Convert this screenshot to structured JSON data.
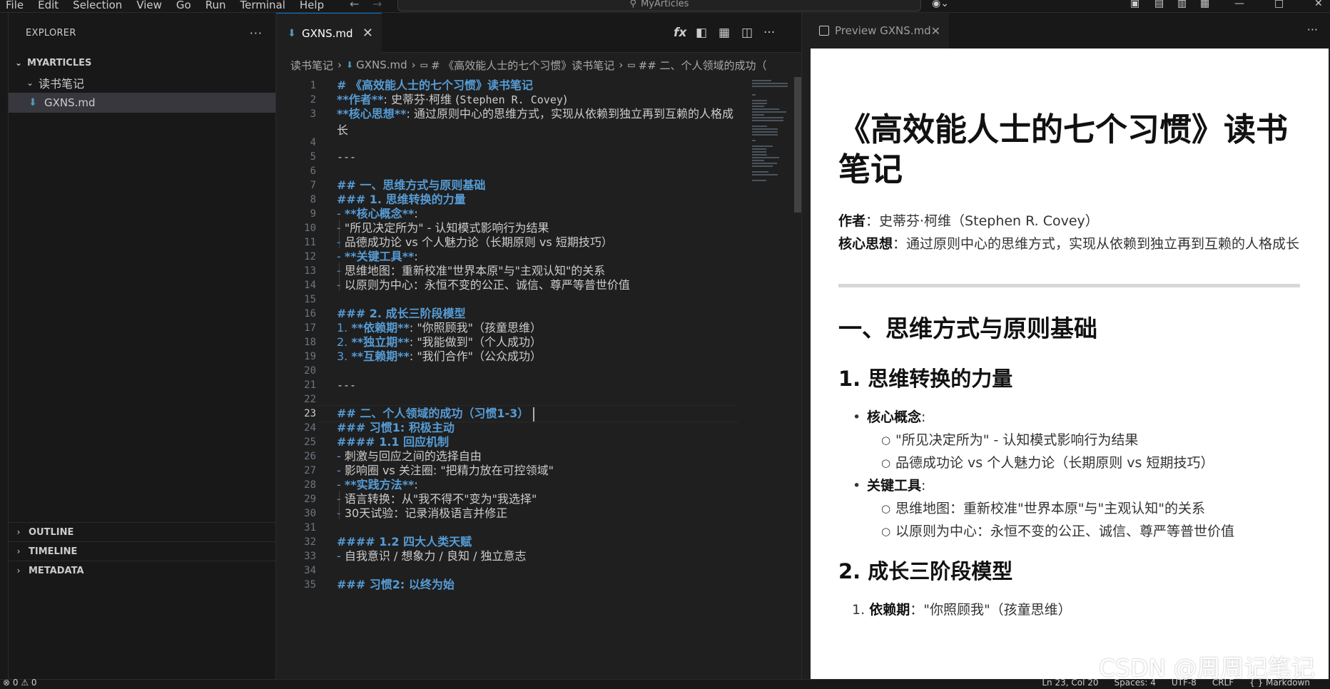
{
  "menu": [
    "File",
    "Edit",
    "Selection",
    "View",
    "Go",
    "Run",
    "Terminal",
    "Help"
  ],
  "command_center": {
    "label": "MyArticles",
    "icon": "search-icon"
  },
  "sidebar": {
    "title": "EXPLORER",
    "root": "MYARTICLES",
    "folder": "读书笔记",
    "file": "GXNS.md",
    "sections": [
      "OUTLINE",
      "TIMELINE",
      "METADATA"
    ]
  },
  "editor": {
    "tab_label": "GXNS.md",
    "breadcrumb": [
      "读书笔记",
      "GXNS.md",
      "# 《高效能人士的七个习惯》读书笔记",
      "## 二、个人领域的成功（"
    ],
    "cursor_line": 23,
    "lines": [
      {
        "n": "1",
        "parts": [
          {
            "t": "# 《高效能人士的七个习惯》读书笔记",
            "c": "hd"
          }
        ]
      },
      {
        "n": "2",
        "parts": [
          {
            "t": "**作者**",
            "c": "bd"
          },
          {
            "t": ": 史蒂芬·柯维 (",
            "c": "plain"
          },
          {
            "t": "Stephen R. Covey",
            "c": "plain mono"
          },
          {
            "t": ")",
            "c": "plain"
          }
        ]
      },
      {
        "n": "3",
        "wrap": true,
        "parts": [
          {
            "t": "**核心思想**",
            "c": "bd"
          },
          {
            "t": ": 通过原则中心的思维方式，实现从依赖到独立再到互赖的人格成长",
            "c": "plain"
          }
        ]
      },
      {
        "n": "4",
        "parts": []
      },
      {
        "n": "5",
        "parts": [
          {
            "t": "---",
            "c": "plain mono"
          }
        ]
      },
      {
        "n": "6",
        "parts": []
      },
      {
        "n": "7",
        "parts": [
          {
            "t": "## 一、思维方式与原则基础",
            "c": "hd"
          }
        ]
      },
      {
        "n": "8",
        "parts": [
          {
            "t": "### 1. 思维转换的力量",
            "c": "hd"
          }
        ]
      },
      {
        "n": "9",
        "parts": [
          {
            "t": "- ",
            "c": "bl"
          },
          {
            "t": "**核心概念**",
            "c": "bd"
          },
          {
            "t": ":",
            "c": "plain"
          }
        ]
      },
      {
        "n": "10",
        "parts": [
          {
            "t": "  - ",
            "c": "bl"
          },
          {
            "t": "\"所见决定所为\" - 认知模式影响行为结果",
            "c": "plain"
          }
        ]
      },
      {
        "n": "11",
        "parts": [
          {
            "t": "  - ",
            "c": "bl"
          },
          {
            "t": "品德成功论 vs 个人魅力论（长期原则 vs 短期技巧）",
            "c": "plain"
          }
        ]
      },
      {
        "n": "12",
        "parts": [
          {
            "t": "- ",
            "c": "bl"
          },
          {
            "t": "**关键工具**",
            "c": "bd"
          },
          {
            "t": ":",
            "c": "plain"
          }
        ]
      },
      {
        "n": "13",
        "parts": [
          {
            "t": "  - ",
            "c": "bl"
          },
          {
            "t": "思维地图：重新校准\"世界本原\"与\"主观认知\"的关系",
            "c": "plain"
          }
        ]
      },
      {
        "n": "14",
        "parts": [
          {
            "t": "  - ",
            "c": "bl"
          },
          {
            "t": "以原则为中心：永恒不变的公正、诚信、尊严等普世价值",
            "c": "plain"
          }
        ]
      },
      {
        "n": "15",
        "parts": []
      },
      {
        "n": "16",
        "parts": [
          {
            "t": "### 2. 成长三阶段模型",
            "c": "hd"
          }
        ]
      },
      {
        "n": "17",
        "parts": [
          {
            "t": "1. ",
            "c": "bl"
          },
          {
            "t": "**依赖期**",
            "c": "bd"
          },
          {
            "t": ": \"你照顾我\"（孩童思维）",
            "c": "plain"
          }
        ]
      },
      {
        "n": "18",
        "parts": [
          {
            "t": "2. ",
            "c": "bl"
          },
          {
            "t": "**独立期**",
            "c": "bd"
          },
          {
            "t": ": \"我能做到\"（个人成功）",
            "c": "plain"
          }
        ]
      },
      {
        "n": "19",
        "parts": [
          {
            "t": "3. ",
            "c": "bl"
          },
          {
            "t": "**互赖期**",
            "c": "bd"
          },
          {
            "t": ": \"我们合作\"（公众成功）",
            "c": "plain"
          }
        ]
      },
      {
        "n": "20",
        "parts": []
      },
      {
        "n": "21",
        "parts": [
          {
            "t": "---",
            "c": "plain mono"
          }
        ]
      },
      {
        "n": "22",
        "parts": []
      },
      {
        "n": "23",
        "parts": [
          {
            "t": "## 二、个人领域的成功（习惯1-3）",
            "c": "hd"
          }
        ]
      },
      {
        "n": "24",
        "parts": [
          {
            "t": "### 习惯1: 积极主动",
            "c": "hd"
          }
        ]
      },
      {
        "n": "25",
        "parts": [
          {
            "t": "#### 1.1 回应机制",
            "c": "hd"
          }
        ]
      },
      {
        "n": "26",
        "parts": [
          {
            "t": "- ",
            "c": "bl"
          },
          {
            "t": "刺激与回应之间的选择自由",
            "c": "plain"
          }
        ]
      },
      {
        "n": "27",
        "parts": [
          {
            "t": "- ",
            "c": "bl"
          },
          {
            "t": "影响圈 vs 关注圈: \"把精力放在可控领域\"",
            "c": "plain"
          }
        ]
      },
      {
        "n": "28",
        "parts": [
          {
            "t": "- ",
            "c": "bl"
          },
          {
            "t": "**实践方法**",
            "c": "bd"
          },
          {
            "t": ":",
            "c": "plain"
          }
        ]
      },
      {
        "n": "29",
        "parts": [
          {
            "t": "  - ",
            "c": "bl"
          },
          {
            "t": "语言转换：从\"我不得不\"变为\"我选择\"",
            "c": "plain"
          }
        ]
      },
      {
        "n": "30",
        "parts": [
          {
            "t": "  - ",
            "c": "bl"
          },
          {
            "t": "30天试验：记录消极语言并修正",
            "c": "plain"
          }
        ]
      },
      {
        "n": "31",
        "parts": []
      },
      {
        "n": "32",
        "parts": [
          {
            "t": "#### 1.2 四大人类天赋",
            "c": "hd"
          }
        ]
      },
      {
        "n": "33",
        "parts": [
          {
            "t": "- ",
            "c": "bl"
          },
          {
            "t": "自我意识 / 想象力 / 良知 / 独立意志",
            "c": "plain"
          }
        ]
      },
      {
        "n": "34",
        "parts": []
      },
      {
        "n": "35",
        "parts": [
          {
            "t": "### 习惯2: 以终为始",
            "c": "hd"
          }
        ]
      }
    ]
  },
  "preview": {
    "tab_label": "Preview GXNS.md",
    "h1": "《高效能人士的七个习惯》读书笔记",
    "author_label": "作者",
    "author_value": "：史蒂芬·柯维（Stephen R. Covey）",
    "core_label": "核心思想",
    "core_value": "：通过原则中心的思维方式，实现从依赖到独立再到互赖的人格成长",
    "h2": "一、思维方式与原则基础",
    "h3_1": "1. 思维转换的力量",
    "concept_label": "核心概念",
    "concept_items": [
      "\"所见决定所为\" - 认知模式影响行为结果",
      "品德成功论 vs 个人魅力论（长期原则 vs 短期技巧）"
    ],
    "tools_label": "关键工具",
    "tools_items": [
      "思维地图：重新校准\"世界本原\"与\"主观认知\"的关系",
      "以原则为中心：永恒不变的公正、诚信、尊严等普世价值"
    ],
    "h3_2": "2. 成长三阶段模型",
    "stage1_num": "1.",
    "stage1_label": "依赖期",
    "stage1_value": "：\"你照顾我\"（孩童思维）"
  },
  "status": {
    "left": "⊗ 0 ⚠ 0",
    "position": "Ln 23, Col 20",
    "spaces": "Spaces: 4",
    "encoding": "UTF-8",
    "eol": "CRLF",
    "language": "{ } Markdown"
  },
  "watermark": "CSDN @周周记笔记",
  "colors": {
    "heading": "#569cd6",
    "accent": "#0078d4",
    "editor_bg": "#1f1f1f",
    "sidebar_bg": "#181818"
  }
}
